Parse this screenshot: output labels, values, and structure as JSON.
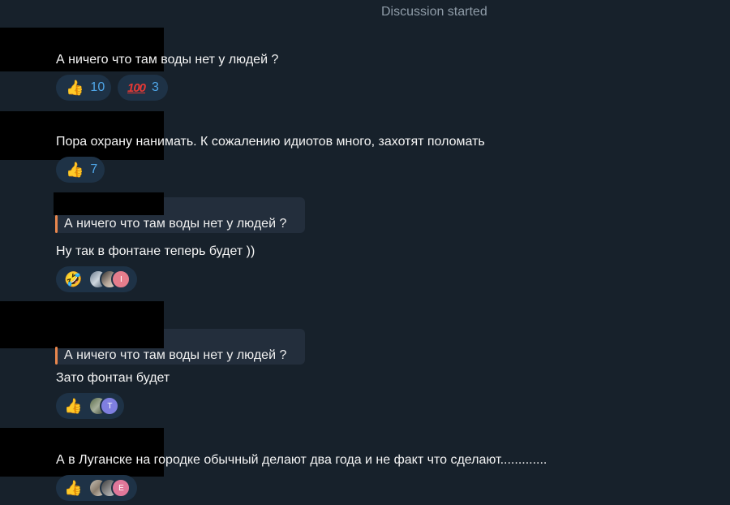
{
  "service_message": "Discussion started",
  "colors": {
    "background": "#17212b",
    "reaction_bg": "#1e3246",
    "accent_count": "#4fa6e8",
    "reply_bar": "#e9874d"
  },
  "messages": [
    {
      "text": "А ничего что там воды нет у людей ?",
      "reactions": [
        {
          "icon": "thumbs-up-icon",
          "emoji": "👍",
          "count": "10"
        },
        {
          "icon": "hundred-points-icon",
          "emoji": "100",
          "count": "3"
        }
      ]
    },
    {
      "text": "Пора охрану нанимать. К сожалению идиотов много, захотят поломать",
      "reactions": [
        {
          "icon": "thumbs-up-icon",
          "emoji": "👍",
          "count": "7"
        }
      ]
    },
    {
      "reply_quote": "А ничего что там воды нет у людей ?",
      "text": "Ну так в фонтане теперь будет ))",
      "reactions": [
        {
          "icon": "rolling-laughing-face-icon",
          "emoji": "🤣",
          "avatar_letter": "I"
        }
      ]
    },
    {
      "reply_quote": "А ничего что там воды нет у людей ?",
      "text": "Зато фонтан будет",
      "reactions": [
        {
          "icon": "thumbs-up-icon",
          "emoji": "👍",
          "avatar_letter": "T"
        }
      ]
    },
    {
      "text": "А в Луганске на городке обычный делают два года и не факт что сделают.............",
      "reactions": [
        {
          "icon": "thumbs-up-icon",
          "emoji": "👍",
          "avatar_letter": "E"
        }
      ]
    }
  ]
}
